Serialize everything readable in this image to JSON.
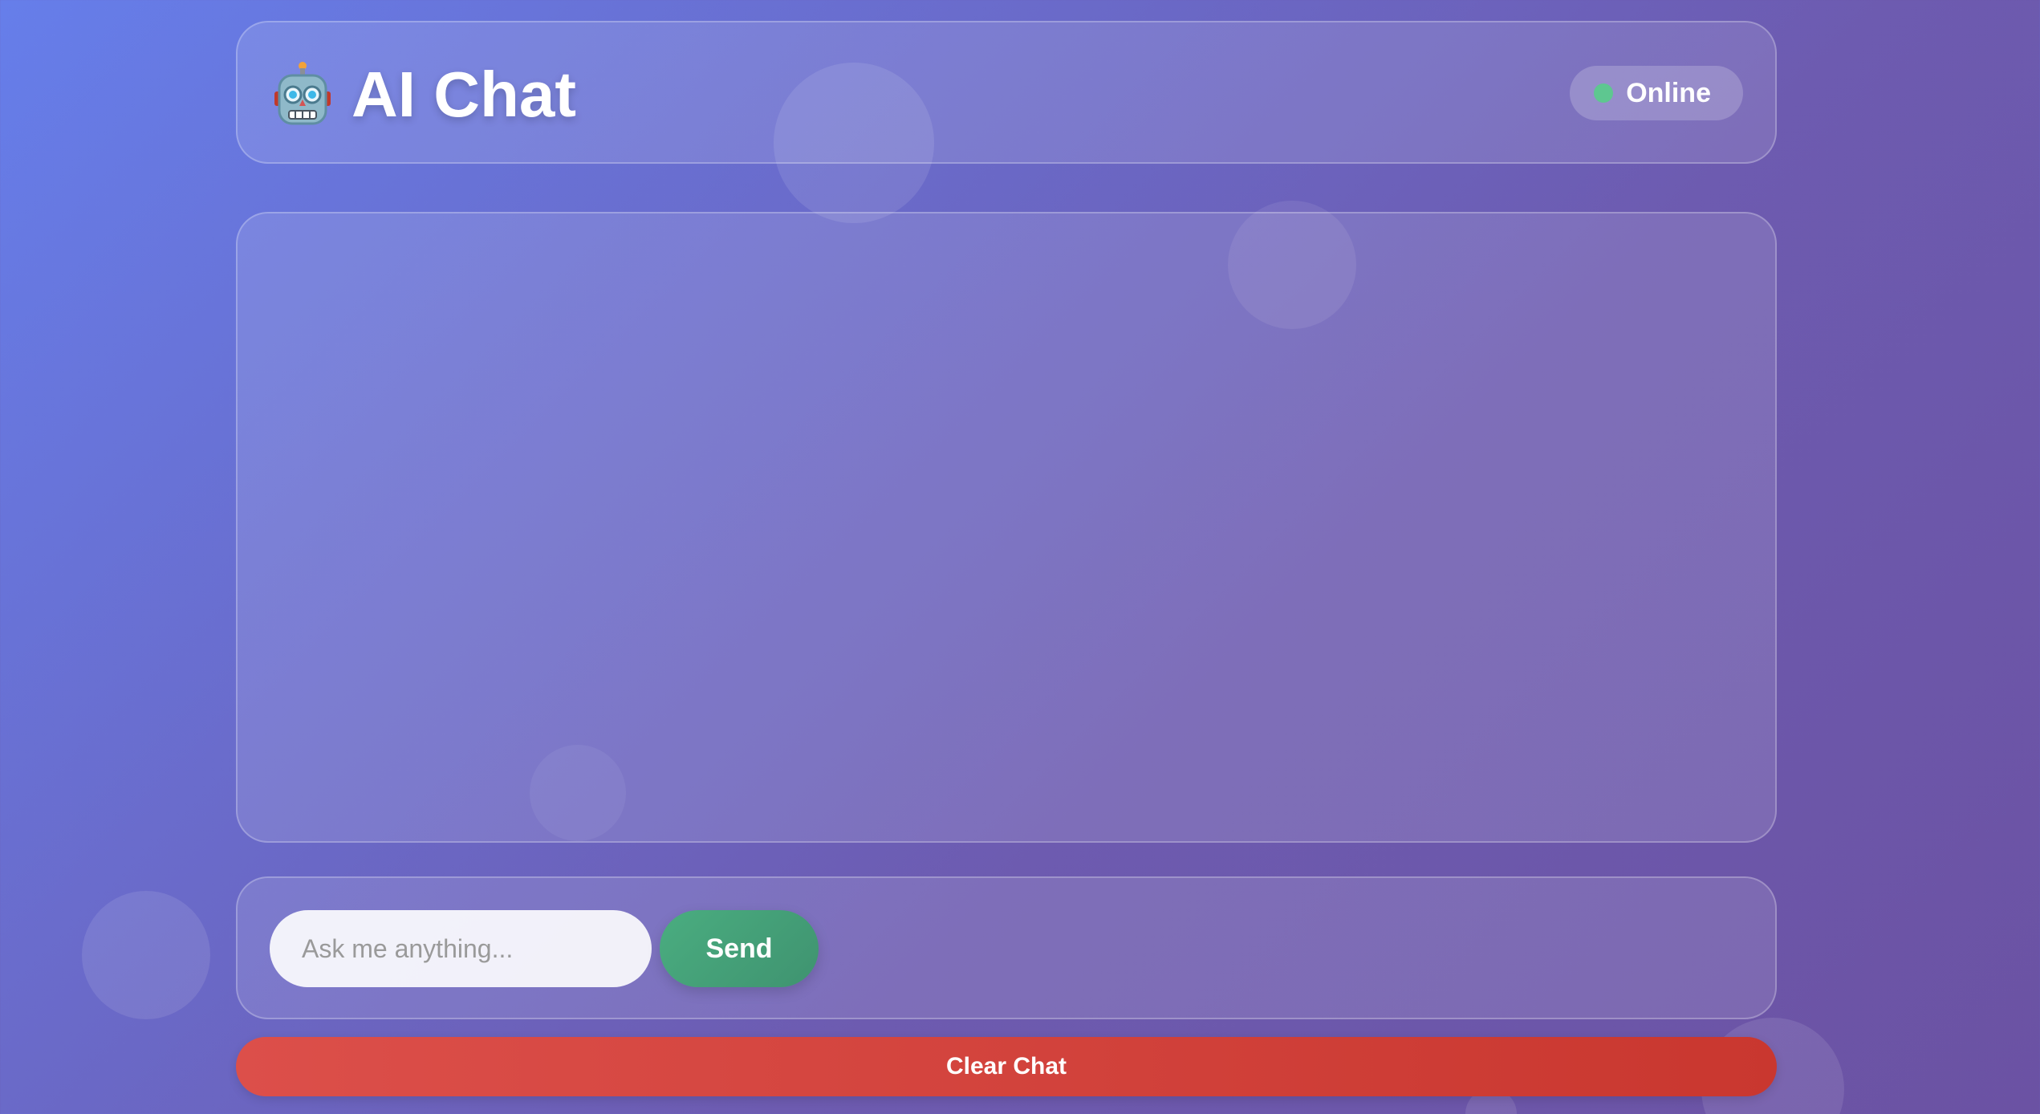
{
  "header": {
    "icon": "robot-face-icon",
    "title": "AI Chat",
    "status": {
      "label": "Online",
      "color": "#5ec790"
    }
  },
  "messages": [],
  "input": {
    "placeholder": "Ask me anything...",
    "value": ""
  },
  "send_label": "Send",
  "clear_label": "Clear Chat",
  "colors": {
    "background_start": "#667eea",
    "background_end": "#6b52a3",
    "send_button": "#4aad80",
    "clear_button": "#dc4f4a"
  }
}
